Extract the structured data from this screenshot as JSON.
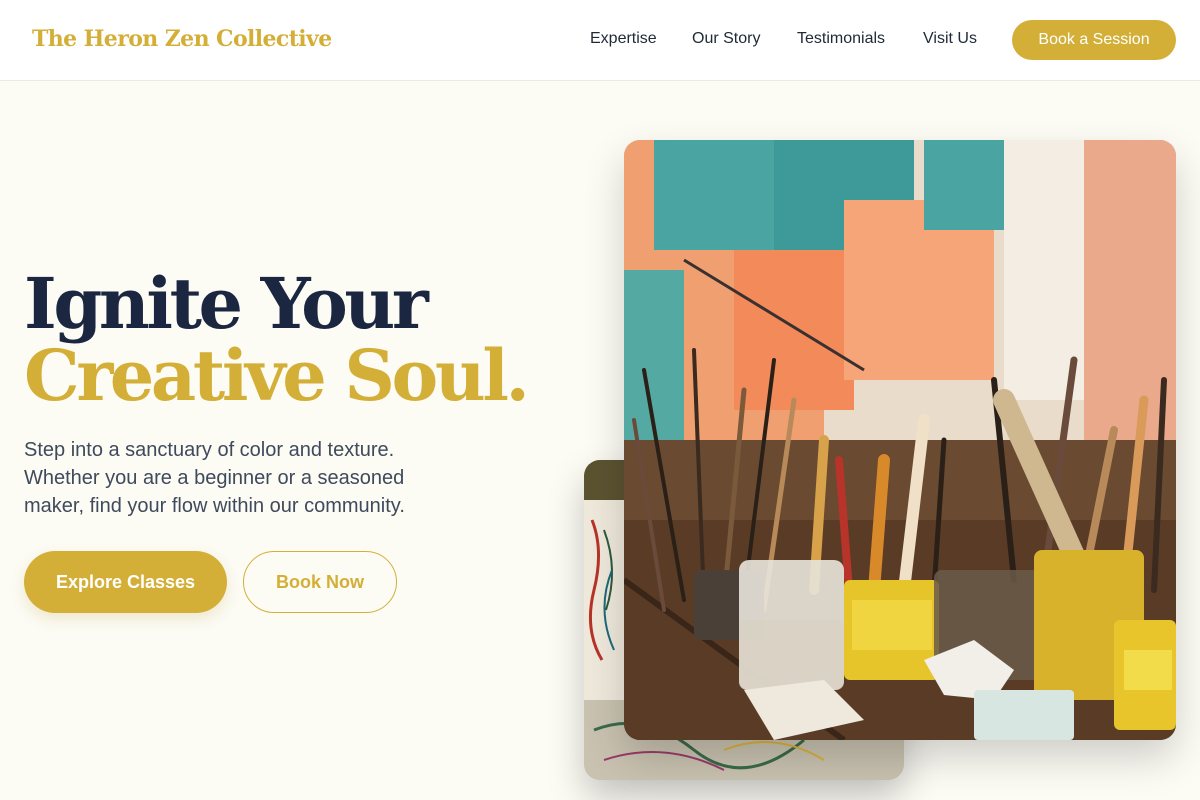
{
  "header": {
    "logo": "The Heron Zen Collective",
    "nav": [
      {
        "label": "Expertise"
      },
      {
        "label": "Our Story"
      },
      {
        "label": "Testimonials"
      },
      {
        "label": "Visit Us"
      }
    ],
    "cta_label": "Book a Session"
  },
  "hero": {
    "headline_line1": "Ignite Your",
    "headline_line2": "Creative Soul.",
    "description": "Step into a sanctuary of color and texture. Whether you are a beginner or a seasoned maker, find your flow within our community.",
    "primary_button": "Explore Classes",
    "secondary_button": "Book Now"
  },
  "colors": {
    "accent": "#d4af37",
    "heading": "#1b2740",
    "background": "#fcfbf4",
    "body_text": "#3f4a5c"
  }
}
